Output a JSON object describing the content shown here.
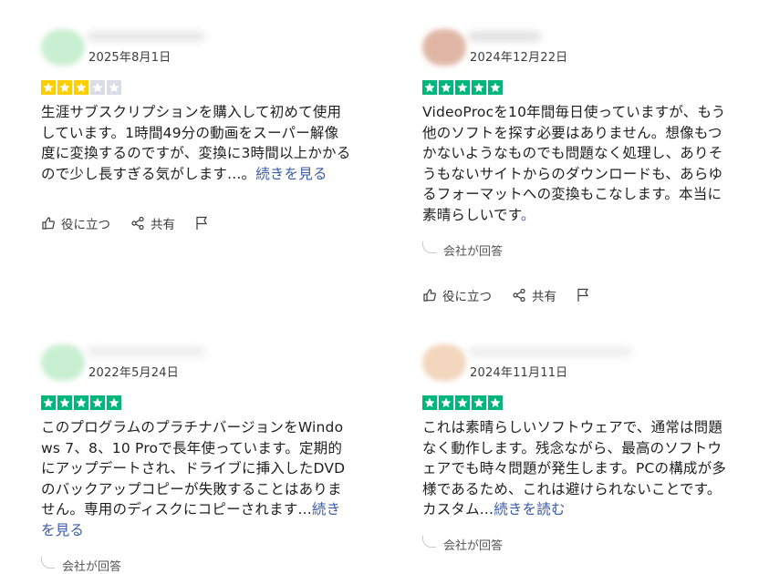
{
  "reviews": [
    {
      "date": "2025年8月1日",
      "rating": 3,
      "avatar_color": "#c9efd2",
      "text": "生涯サブスクリプションを購入して初めて使用しています。1時間49分の動画をスーパー解像度に変換するのですが、変換に3時間以上かかるので少し長すぎる気がします...。",
      "more": "続きを見る",
      "reply": "",
      "helpful": "役に立つ",
      "share": "共有"
    },
    {
      "date": "2024年12月22日",
      "rating": 5,
      "avatar_color": "#e0b7a6",
      "text": "VideoProcを10年間毎日使っていますが、もう他のソフトを探す必要はありません。想像もつかないようなものでも問題なく処理し、ありそうもないサイトからのダウンロードも、あらゆるフォーマットへの変換もこなします。本当に素晴らしいです",
      "more": "。",
      "reply": "会社が回答",
      "helpful": "役に立つ",
      "share": "共有"
    },
    {
      "date": "2022年5月24日",
      "rating": 5,
      "avatar_color": "#c9efd2",
      "text": "このプログラムのプラチナバージョンをWindows 7、8、10 Proで長年使っています。定期的にアップデートされ、ドライブに挿入したDVDのバックアップコピーが失敗することはありません。専用のディスクにコピーされます...",
      "more": "続きを見る",
      "reply": "会社が回答",
      "helpful": "",
      "share": ""
    },
    {
      "date": "2024年11月11日",
      "rating": 5,
      "avatar_color": "#f2d6bd",
      "text": "これは素晴らしいソフトウェアで、通常は問題なく動作します。残念ながら、最高のソフトウェアでも時々問題が発生します。PCの構成が多様であるため、これは避けられないことです。カスタム...",
      "more": "続きを読む",
      "reply": "会社が回答",
      "helpful": "",
      "share": ""
    }
  ],
  "colors": {
    "star_filled": "#00b67a",
    "star_partial": "#ffce00",
    "star_empty": "#dcdce6",
    "link": "#3a5ba7"
  },
  "icons": {
    "helpful": "thumbs-up-icon",
    "share": "share-icon",
    "flag": "flag-icon",
    "reply": "reply-curve-icon"
  }
}
